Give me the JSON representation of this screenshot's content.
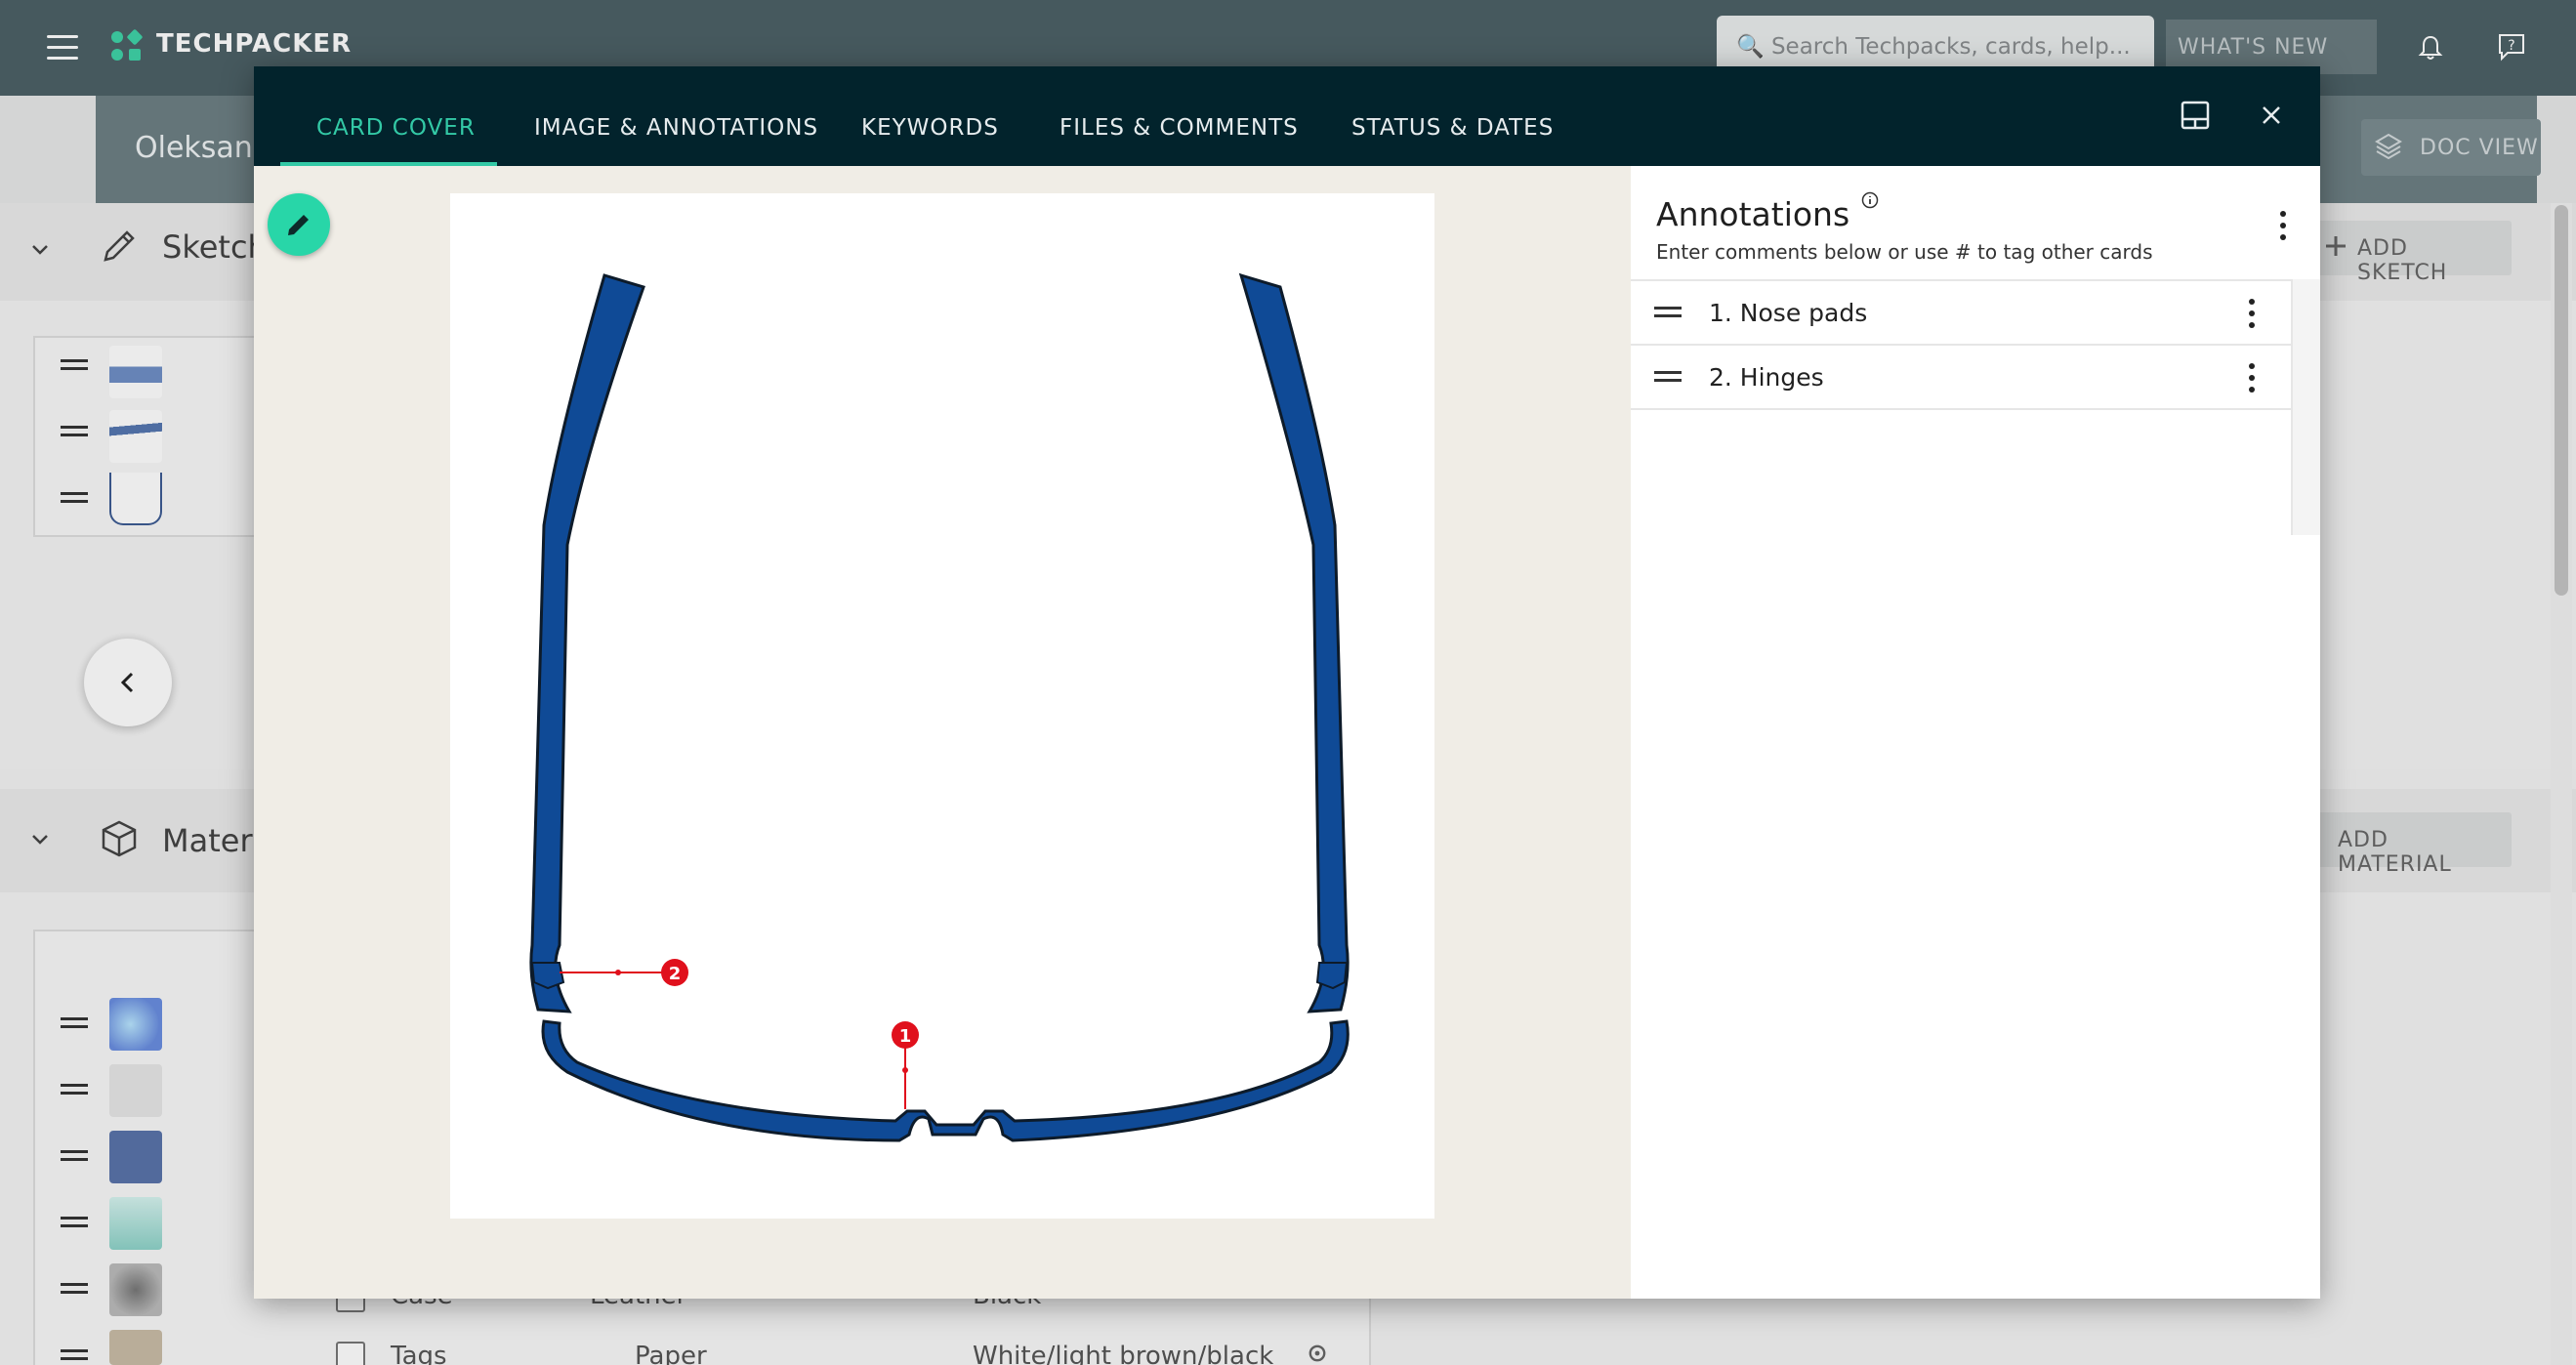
{
  "app": {
    "brand": "TECHPACKER",
    "search_placeholder": "🔍 Search Techpacks, cards, help...",
    "whats_new": "WHAT'S NEW"
  },
  "subbar": {
    "user_name": "Oleksan",
    "doc_view": "DOC VIEW"
  },
  "sections": {
    "sketches": {
      "title": "Sketch",
      "add_label": "ADD SKETCH"
    },
    "materials": {
      "title": "Materi",
      "add_label": "ADD MATERIAL"
    },
    "material_rows": [
      {
        "name": "Case",
        "material": "Leather",
        "color": "Black"
      },
      {
        "name": "Tags",
        "material": "Paper",
        "color": "White/light brown/black"
      }
    ]
  },
  "modal": {
    "tabs": [
      {
        "label": "CARD COVER",
        "active": true
      },
      {
        "label": "IMAGE & ANNOTATIONS",
        "active": false
      },
      {
        "label": "KEYWORDS",
        "active": false
      },
      {
        "label": "FILES & COMMENTS",
        "active": false
      },
      {
        "label": "STATUS & DATES",
        "active": false
      }
    ],
    "image_markers": [
      {
        "number": "1",
        "annotation": "Nose pads"
      },
      {
        "number": "2",
        "annotation": "Hinges"
      }
    ],
    "annotations": {
      "title": "Annotations",
      "subtitle": "Enter comments below or use # to tag other cards",
      "items": [
        {
          "label": "1.  Nose pads"
        },
        {
          "label": "2.  Hinges"
        }
      ]
    }
  },
  "colors": {
    "appbar": "#4d6166",
    "modal_header": "#02232c",
    "accent": "#33c9a6",
    "frame_blue": "#0f4a96",
    "marker_red": "#e0101c"
  },
  "icons": [
    "menu-icon",
    "techpacker-logo",
    "bell-icon",
    "help-icon",
    "layers-icon",
    "pencil-icon",
    "cube-icon",
    "chevron-left-icon",
    "edit-icon",
    "layout-icon",
    "close-icon",
    "info-icon",
    "drag-handle-icon",
    "more-vert-icon"
  ]
}
